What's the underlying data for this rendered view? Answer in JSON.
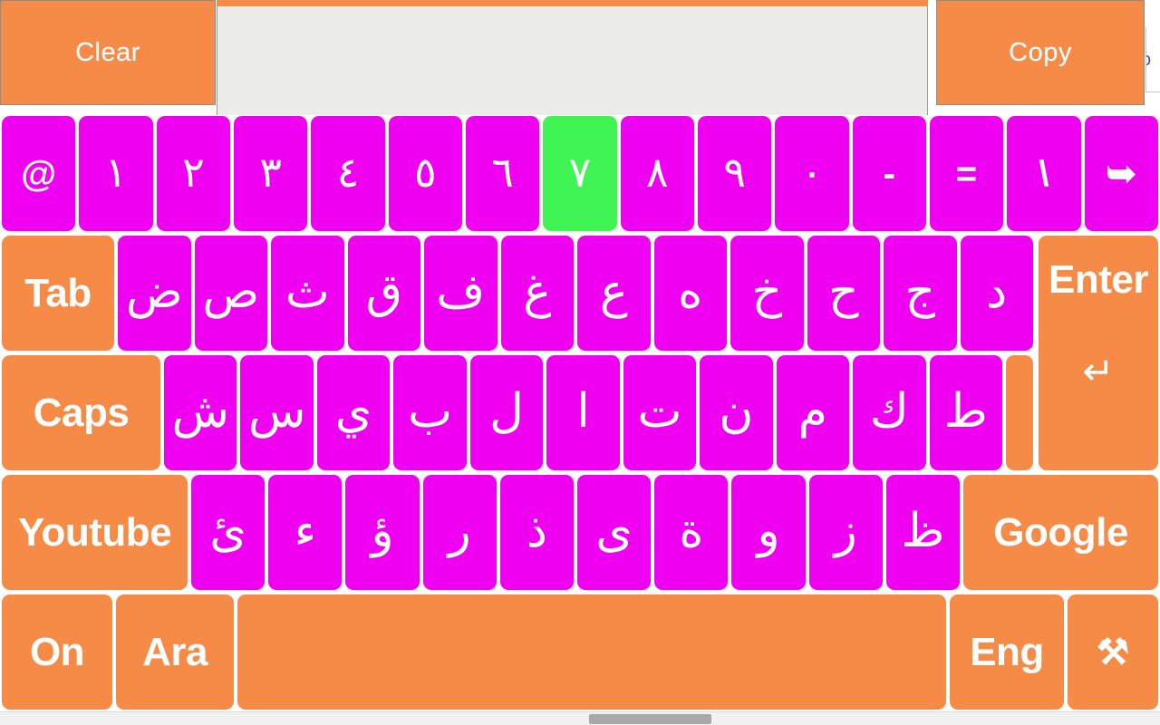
{
  "topbar": {
    "clear_label": "Clear",
    "copy_label": "Copy",
    "display_value": "",
    "display_placeholder": "",
    "edge_sliver_text": "o"
  },
  "colors": {
    "key_magenta": "#f000f0",
    "key_green": "#3ff453",
    "key_orange": "#f58b46",
    "key_text": "#ffffff",
    "display_bg": "#ececeb",
    "page_bg": "#ffffff"
  },
  "keyboard": {
    "rows": [
      {
        "name": "number-row",
        "keys": [
          {
            "label": "@",
            "name": "key-at",
            "color": "magenta",
            "kind": "sym"
          },
          {
            "label": "١",
            "name": "key-arabic-one",
            "color": "magenta",
            "kind": "num"
          },
          {
            "label": "٢",
            "name": "key-arabic-two",
            "color": "magenta",
            "kind": "num"
          },
          {
            "label": "٣",
            "name": "key-arabic-three",
            "color": "magenta",
            "kind": "num"
          },
          {
            "label": "٤",
            "name": "key-arabic-four",
            "color": "magenta",
            "kind": "num"
          },
          {
            "label": "٥",
            "name": "key-arabic-five",
            "color": "magenta",
            "kind": "num"
          },
          {
            "label": "٦",
            "name": "key-arabic-six",
            "color": "magenta",
            "kind": "num"
          },
          {
            "label": "٧",
            "name": "key-arabic-seven",
            "color": "green",
            "kind": "num"
          },
          {
            "label": "٨",
            "name": "key-arabic-eight",
            "color": "magenta",
            "kind": "num"
          },
          {
            "label": "٩",
            "name": "key-arabic-nine",
            "color": "magenta",
            "kind": "num"
          },
          {
            "label": "٠",
            "name": "key-arabic-zero",
            "color": "magenta",
            "kind": "num"
          },
          {
            "label": "-",
            "name": "key-minus",
            "color": "magenta",
            "kind": "sym"
          },
          {
            "label": "=",
            "name": "key-equals",
            "color": "magenta",
            "kind": "sym"
          },
          {
            "label": "\\",
            "name": "key-backslash",
            "color": "magenta",
            "kind": "sym"
          },
          {
            "label": "➥",
            "name": "backspace-icon",
            "color": "magenta",
            "kind": "sym"
          }
        ]
      },
      {
        "name": "tab-row",
        "keys": [
          {
            "label": "Tab",
            "name": "key-tab",
            "color": "orange",
            "kind": "lbl"
          },
          {
            "label": "ض",
            "name": "key-dad",
            "color": "magenta",
            "kind": "ar"
          },
          {
            "label": "ص",
            "name": "key-sad",
            "color": "magenta",
            "kind": "ar"
          },
          {
            "label": "ث",
            "name": "key-tha",
            "color": "magenta",
            "kind": "ar"
          },
          {
            "label": "ق",
            "name": "key-qaf",
            "color": "magenta",
            "kind": "ar"
          },
          {
            "label": "ف",
            "name": "key-fa",
            "color": "magenta",
            "kind": "ar"
          },
          {
            "label": "غ",
            "name": "key-ghain",
            "color": "magenta",
            "kind": "ar"
          },
          {
            "label": "ع",
            "name": "key-ain",
            "color": "magenta",
            "kind": "ar"
          },
          {
            "label": "ه",
            "name": "key-ha",
            "color": "magenta",
            "kind": "ar"
          },
          {
            "label": "خ",
            "name": "key-kha",
            "color": "magenta",
            "kind": "ar"
          },
          {
            "label": "ح",
            "name": "key-hah",
            "color": "magenta",
            "kind": "ar"
          },
          {
            "label": "ج",
            "name": "key-jeem",
            "color": "magenta",
            "kind": "ar"
          },
          {
            "label": "د",
            "name": "key-dal",
            "color": "magenta",
            "kind": "ar"
          }
        ]
      },
      {
        "name": "caps-row",
        "keys": [
          {
            "label": "Caps",
            "name": "key-caps",
            "color": "orange",
            "kind": "lbl"
          },
          {
            "label": "ش",
            "name": "key-sheen",
            "color": "magenta",
            "kind": "ar"
          },
          {
            "label": "س",
            "name": "key-seen",
            "color": "magenta",
            "kind": "ar"
          },
          {
            "label": "ي",
            "name": "key-ya",
            "color": "magenta",
            "kind": "ar"
          },
          {
            "label": "ب",
            "name": "key-ba",
            "color": "magenta",
            "kind": "ar"
          },
          {
            "label": "ل",
            "name": "key-lam",
            "color": "magenta",
            "kind": "ar"
          },
          {
            "label": "ا",
            "name": "key-alef",
            "color": "magenta",
            "kind": "ar"
          },
          {
            "label": "ت",
            "name": "key-ta",
            "color": "magenta",
            "kind": "ar"
          },
          {
            "label": "ن",
            "name": "key-noon",
            "color": "magenta",
            "kind": "ar"
          },
          {
            "label": "م",
            "name": "key-meem",
            "color": "magenta",
            "kind": "ar"
          },
          {
            "label": "ك",
            "name": "key-kaf",
            "color": "magenta",
            "kind": "ar"
          },
          {
            "label": "ط",
            "name": "key-tah",
            "color": "magenta",
            "kind": "ar"
          },
          {
            "label": "",
            "name": "key-blank",
            "color": "orange",
            "kind": "sym"
          }
        ]
      },
      {
        "name": "shift-row",
        "keys": [
          {
            "label": "Youtube",
            "name": "key-youtube",
            "color": "orange",
            "kind": "lbl"
          },
          {
            "label": "ئ",
            "name": "key-yeh-hamza",
            "color": "magenta",
            "kind": "ar"
          },
          {
            "label": "ء",
            "name": "key-hamza",
            "color": "magenta",
            "kind": "ar"
          },
          {
            "label": "ؤ",
            "name": "key-waw-hamza",
            "color": "magenta",
            "kind": "ar"
          },
          {
            "label": "ر",
            "name": "key-ra",
            "color": "magenta",
            "kind": "ar"
          },
          {
            "label": "ذ",
            "name": "key-thal",
            "color": "magenta",
            "kind": "ar"
          },
          {
            "label": "ى",
            "name": "key-alef-maksura",
            "color": "magenta",
            "kind": "ar"
          },
          {
            "label": "ة",
            "name": "key-ta-marbuta",
            "color": "magenta",
            "kind": "ar"
          },
          {
            "label": "و",
            "name": "key-waw",
            "color": "magenta",
            "kind": "ar"
          },
          {
            "label": "ز",
            "name": "key-zain",
            "color": "magenta",
            "kind": "ar"
          },
          {
            "label": "ظ",
            "name": "key-zah",
            "color": "magenta",
            "kind": "ar"
          },
          {
            "label": "Google",
            "name": "key-google",
            "color": "orange",
            "kind": "lbl"
          }
        ]
      },
      {
        "name": "space-row",
        "keys": [
          {
            "label": "On",
            "name": "key-on",
            "color": "orange",
            "kind": "lbl"
          },
          {
            "label": "Ara",
            "name": "key-arabic-layout",
            "color": "orange",
            "kind": "lbl"
          },
          {
            "label": "",
            "name": "key-space",
            "color": "orange",
            "kind": "lbl"
          },
          {
            "label": "Eng",
            "name": "key-english-layout",
            "color": "orange",
            "kind": "lbl"
          },
          {
            "label": "⚒",
            "name": "tools-icon",
            "color": "orange",
            "kind": "sym"
          }
        ]
      }
    ],
    "enter": {
      "label": "Enter",
      "arrow": "↵"
    }
  },
  "scrollbar": {
    "orientation": "horizontal"
  }
}
